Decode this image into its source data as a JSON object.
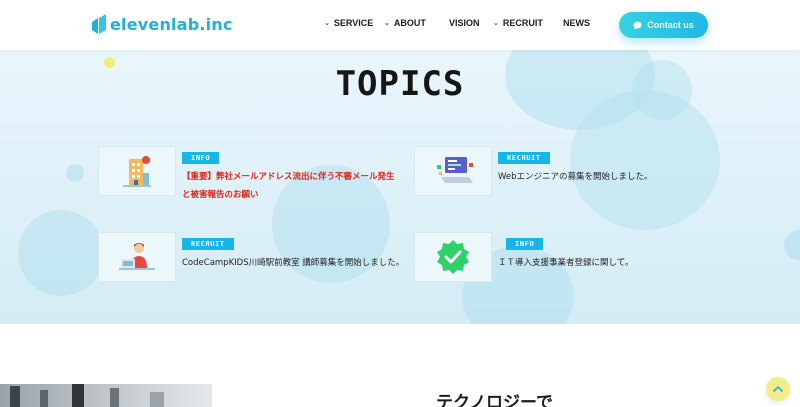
{
  "header": {
    "logo_text": "elevenlab.inc",
    "nav": [
      {
        "label": "SERVICE",
        "has_dropdown": true
      },
      {
        "label": "ABOUT",
        "has_dropdown": true
      },
      {
        "label": "VISION",
        "has_dropdown": false
      },
      {
        "label": "RECRUIT",
        "has_dropdown": true
      },
      {
        "label": "NEWS",
        "has_dropdown": false
      }
    ],
    "contact_label": "Contact us"
  },
  "topics": {
    "title": "TOPICS",
    "items": [
      {
        "tag": "INFO",
        "text_line1": "【重要】弊社メールアドレス流出に伴う不審メール発生",
        "text_line2": "と被害報告のお願い",
        "important": true,
        "icon": "building-icon"
      },
      {
        "tag": "RECRUIT",
        "text_line1": "Webエンジニアの募集を開始しました。",
        "text_line2": "",
        "important": false,
        "icon": "laptop-code-icon"
      },
      {
        "tag": "RECRUIT",
        "text_line1": "CodeCampKIDS川崎駅前教室 講師募集を開始しました。",
        "text_line2": "",
        "important": false,
        "icon": "teacher-icon"
      },
      {
        "tag": "INFO",
        "text_line1": "ＩＴ導入支援事業者登録に関して。",
        "text_line2": "",
        "important": false,
        "icon": "check-badge-icon"
      }
    ]
  },
  "below": {
    "heading": "テクノロジーで"
  },
  "colors": {
    "brand": "#1fb2d4",
    "tag": "#17b6e8",
    "important": "#e2231a",
    "badge_green": "#2fcf6a"
  }
}
